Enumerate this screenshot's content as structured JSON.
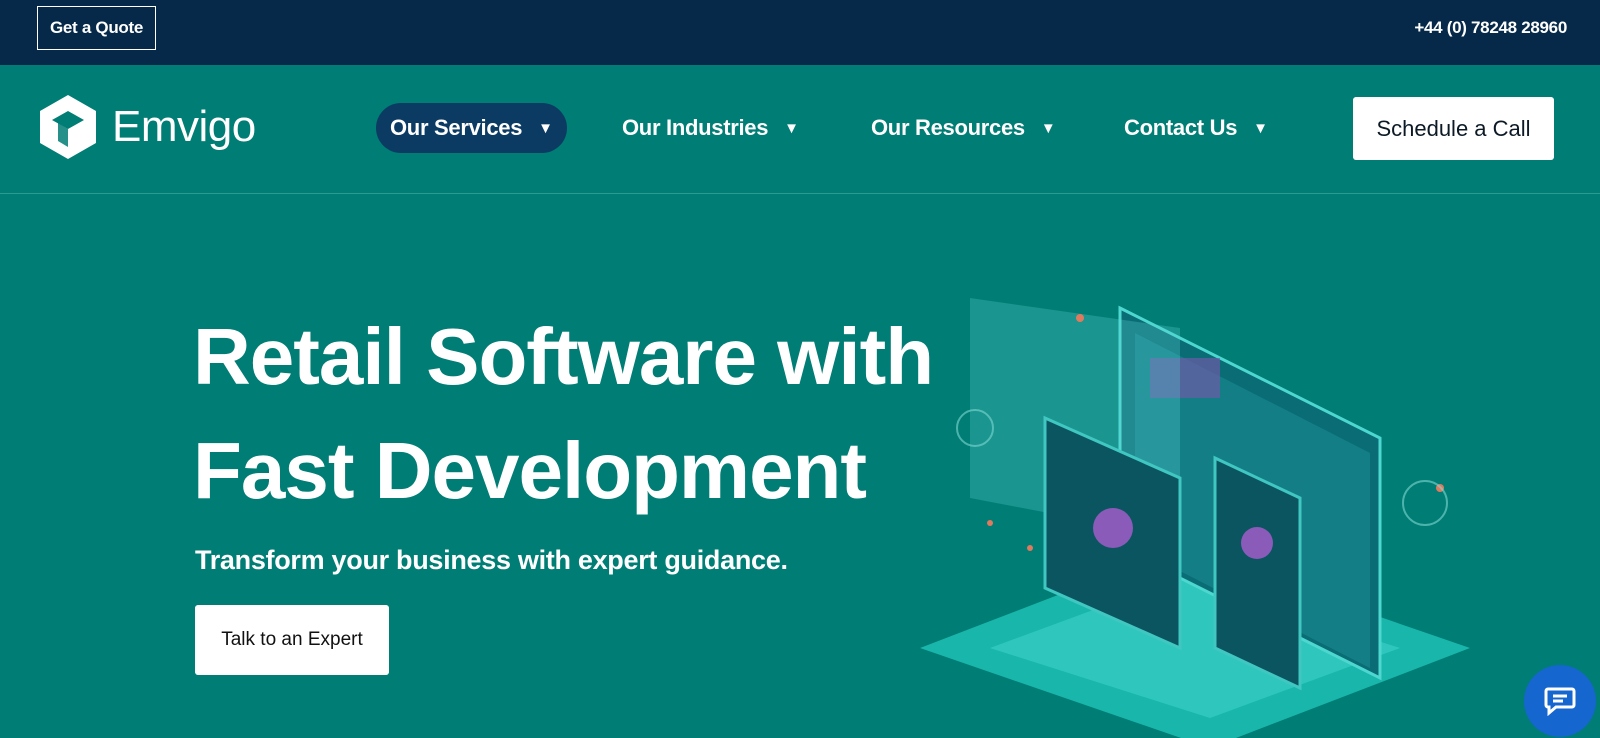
{
  "topbar": {
    "quote_label": "Get a Quote",
    "phone": "+44 (0) 78248 28960"
  },
  "brand": {
    "name": "Emvigo"
  },
  "nav": {
    "items": [
      {
        "label": "Our Services",
        "active": true
      },
      {
        "label": "Our Industries",
        "active": false
      },
      {
        "label": "Our Resources",
        "active": false
      },
      {
        "label": "Contact Us",
        "active": false
      }
    ],
    "cta_label": "Schedule a Call"
  },
  "hero": {
    "title_line1": "Retail Software with",
    "title_line2": "Fast Development",
    "subtitle": "Transform your business with expert guidance.",
    "cta_label": "Talk to an Expert"
  },
  "icons": {
    "logo": "emvigo-cube-logo",
    "caret": "caret-down-icon",
    "chat": "chat-bubble-icon"
  },
  "colors": {
    "topbar_bg": "#06294a",
    "main_bg": "#007d74",
    "active_nav_bg": "#0b3a63",
    "chat_bg": "#1566cf"
  }
}
